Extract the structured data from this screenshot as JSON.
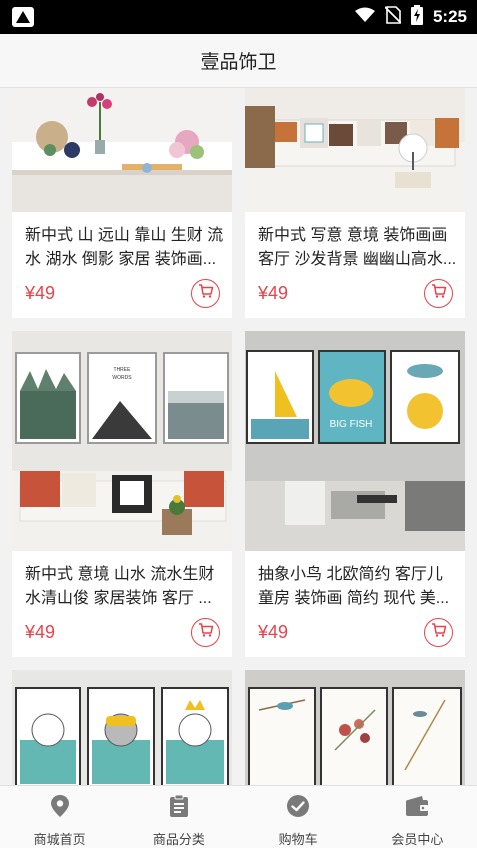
{
  "status_bar": {
    "time": "5:25"
  },
  "header": {
    "title": "壹品饰卫"
  },
  "products": [
    {
      "title": "新中式 山 远山 靠山 生财 流水 湖水 倒影 家居 装饰画...",
      "price": "¥49"
    },
    {
      "title": "新中式 写意 意境 装饰画画客厅 沙发背景 幽幽山高水...",
      "price": "¥49"
    },
    {
      "title": "新中式 意境 山水 流水生财水清山俊 家居装饰 客厅 ...",
      "price": "¥49"
    },
    {
      "title": "抽象小鸟 北欧简约 客厅儿童房 装饰画 简约 现代 美...",
      "price": "¥49"
    }
  ],
  "tabs": [
    {
      "label": "商城首页",
      "icon": "location-pin-icon"
    },
    {
      "label": "商品分类",
      "icon": "clipboard-icon"
    },
    {
      "label": "购物车",
      "icon": "check-circle-icon"
    },
    {
      "label": "会员中心",
      "icon": "wallet-icon"
    }
  ],
  "colors": {
    "accent": "#e8434a",
    "tab_icon": "#7a7a7a"
  }
}
